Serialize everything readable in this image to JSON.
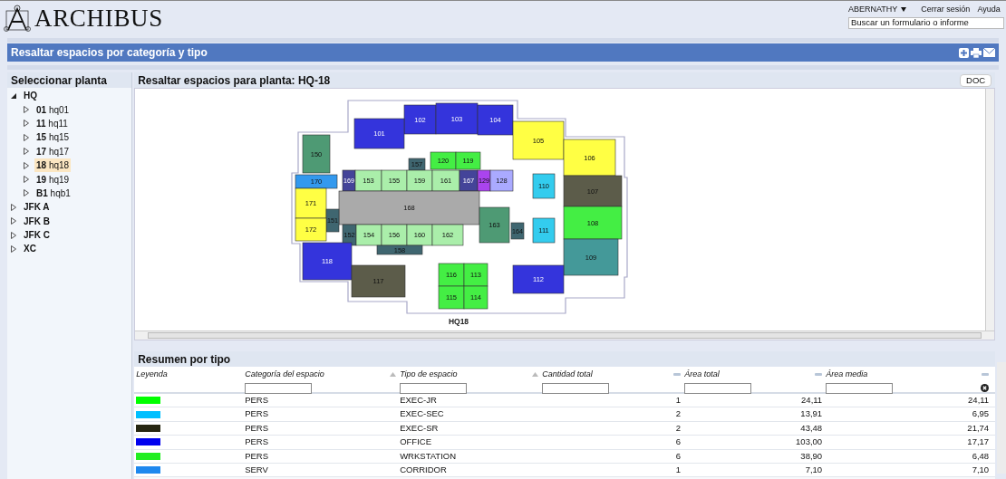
{
  "header": {
    "logo": "ARCHIBUS",
    "user": "ABERNATHY",
    "links": [
      "Cerrar sesión",
      "Ayuda"
    ],
    "search": {
      "placeholder": "Buscar un formulario o informe"
    }
  },
  "title": "Resaltar espacios por categoría y tipo",
  "tree": {
    "title": "Seleccionar planta",
    "items": [
      {
        "code": "HQ",
        "expanded": true,
        "selected": false,
        "children": [
          {
            "code": "01",
            "name": "hq01",
            "expanded": false,
            "selected": false
          },
          {
            "code": "11",
            "name": "hq11",
            "expanded": false,
            "selected": false
          },
          {
            "code": "15",
            "name": "hq15",
            "expanded": false,
            "selected": false
          },
          {
            "code": "17",
            "name": "hq17",
            "expanded": false,
            "selected": false
          },
          {
            "code": "18",
            "name": "hq18",
            "expanded": false,
            "selected": true
          },
          {
            "code": "19",
            "name": "hq19",
            "expanded": false,
            "selected": false
          },
          {
            "code": "B1",
            "name": "hqb1",
            "expanded": false,
            "selected": false
          }
        ]
      },
      {
        "code": "JFK A",
        "expanded": false,
        "selected": false
      },
      {
        "code": "JFK B",
        "expanded": false,
        "selected": false
      },
      {
        "code": "JFK C",
        "expanded": false,
        "selected": false
      },
      {
        "code": "XC",
        "expanded": false,
        "selected": false
      }
    ]
  },
  "drawing": {
    "title": "Resaltar espacios para planta: HQ-18",
    "doc_button": "DOC",
    "floor_label": "HQ18",
    "rooms": [
      {
        "label": "102",
        "color": "#3434dc"
      },
      {
        "label": "103",
        "color": "#3434dc"
      },
      {
        "label": "104",
        "color": "#3434dc"
      },
      {
        "label": "101",
        "color": "#3434dc"
      },
      {
        "label": "105",
        "color": "#ffff44"
      },
      {
        "label": "150",
        "color": "#4e9a74"
      },
      {
        "label": "106",
        "color": "#ffff44"
      },
      {
        "label": "120",
        "color": "#44ee44"
      },
      {
        "label": "119",
        "color": "#44ee44"
      },
      {
        "label": "157",
        "color": "#3f6670"
      },
      {
        "label": "170",
        "color": "#3399ee"
      },
      {
        "label": "169",
        "color": "#444499"
      },
      {
        "label": "153",
        "color": "#aaeeaa"
      },
      {
        "label": "155",
        "color": "#aaeeaa"
      },
      {
        "label": "159",
        "color": "#aaeeaa"
      },
      {
        "label": "161",
        "color": "#aaeeaa"
      },
      {
        "label": "167",
        "color": "#444499"
      },
      {
        "label": "129",
        "color": "#aa44ee"
      },
      {
        "label": "128",
        "color": "#aaaaff"
      },
      {
        "label": "110",
        "color": "#33ccee"
      },
      {
        "label": "107",
        "color": "#5c5c4a"
      },
      {
        "label": "171",
        "color": "#ffff44"
      },
      {
        "label": "168",
        "color": "#aaaaaa"
      },
      {
        "label": "151",
        "color": "#3f6670"
      },
      {
        "label": "163",
        "color": "#4e9a74"
      },
      {
        "label": "108",
        "color": "#44ee44"
      },
      {
        "label": "172",
        "color": "#ffff44"
      },
      {
        "label": "152",
        "color": "#3f6670"
      },
      {
        "label": "154",
        "color": "#aaeeaa"
      },
      {
        "label": "156",
        "color": "#aaeeaa"
      },
      {
        "label": "160",
        "color": "#aaeeaa"
      },
      {
        "label": "162",
        "color": "#aaeeaa"
      },
      {
        "label": "164",
        "color": "#3f6670"
      },
      {
        "label": "111",
        "color": "#33ccee"
      },
      {
        "label": "158",
        "color": "#3f6670"
      },
      {
        "label": "118",
        "color": "#3434dc"
      },
      {
        "label": "109",
        "color": "#449999"
      },
      {
        "label": "116",
        "color": "#44ee44"
      },
      {
        "label": "113",
        "color": "#44ee44"
      },
      {
        "label": "117",
        "color": "#5c5c4a"
      },
      {
        "label": "112",
        "color": "#3434dc"
      },
      {
        "label": "115",
        "color": "#44ee44"
      },
      {
        "label": "114",
        "color": "#44ee44"
      }
    ]
  },
  "grid": {
    "title": "Resumen por tipo",
    "columns": [
      {
        "label": "Leyenda",
        "filter": false
      },
      {
        "label": "Categoría del espacio",
        "filter": true
      },
      {
        "label": "Tipo de espacio",
        "filter": true
      },
      {
        "label": "Cantidad total",
        "filter": true
      },
      {
        "label": "Área total",
        "filter": true
      },
      {
        "label": "Área media",
        "filter": true
      }
    ],
    "rows": [
      {
        "color": "#00ff00",
        "category": "PERS",
        "type": "EXEC-JR",
        "count": "1",
        "total": "24,11",
        "mean": "24,11"
      },
      {
        "color": "#00bfff",
        "category": "PERS",
        "type": "EXEC-SEC",
        "count": "2",
        "total": "13,91",
        "mean": "6,95"
      },
      {
        "color": "#262611",
        "category": "PERS",
        "type": "EXEC-SR",
        "count": "2",
        "total": "43,48",
        "mean": "21,74"
      },
      {
        "color": "#0000ee",
        "category": "PERS",
        "type": "OFFICE",
        "count": "6",
        "total": "103,00",
        "mean": "17,17"
      },
      {
        "color": "#22ee22",
        "category": "PERS",
        "type": "WRKSTATION",
        "count": "6",
        "total": "38,90",
        "mean": "6,48"
      },
      {
        "color": "#1e88ee",
        "category": "SERV",
        "type": "CORRIDOR",
        "count": "1",
        "total": "7,10",
        "mean": "7,10"
      }
    ]
  }
}
